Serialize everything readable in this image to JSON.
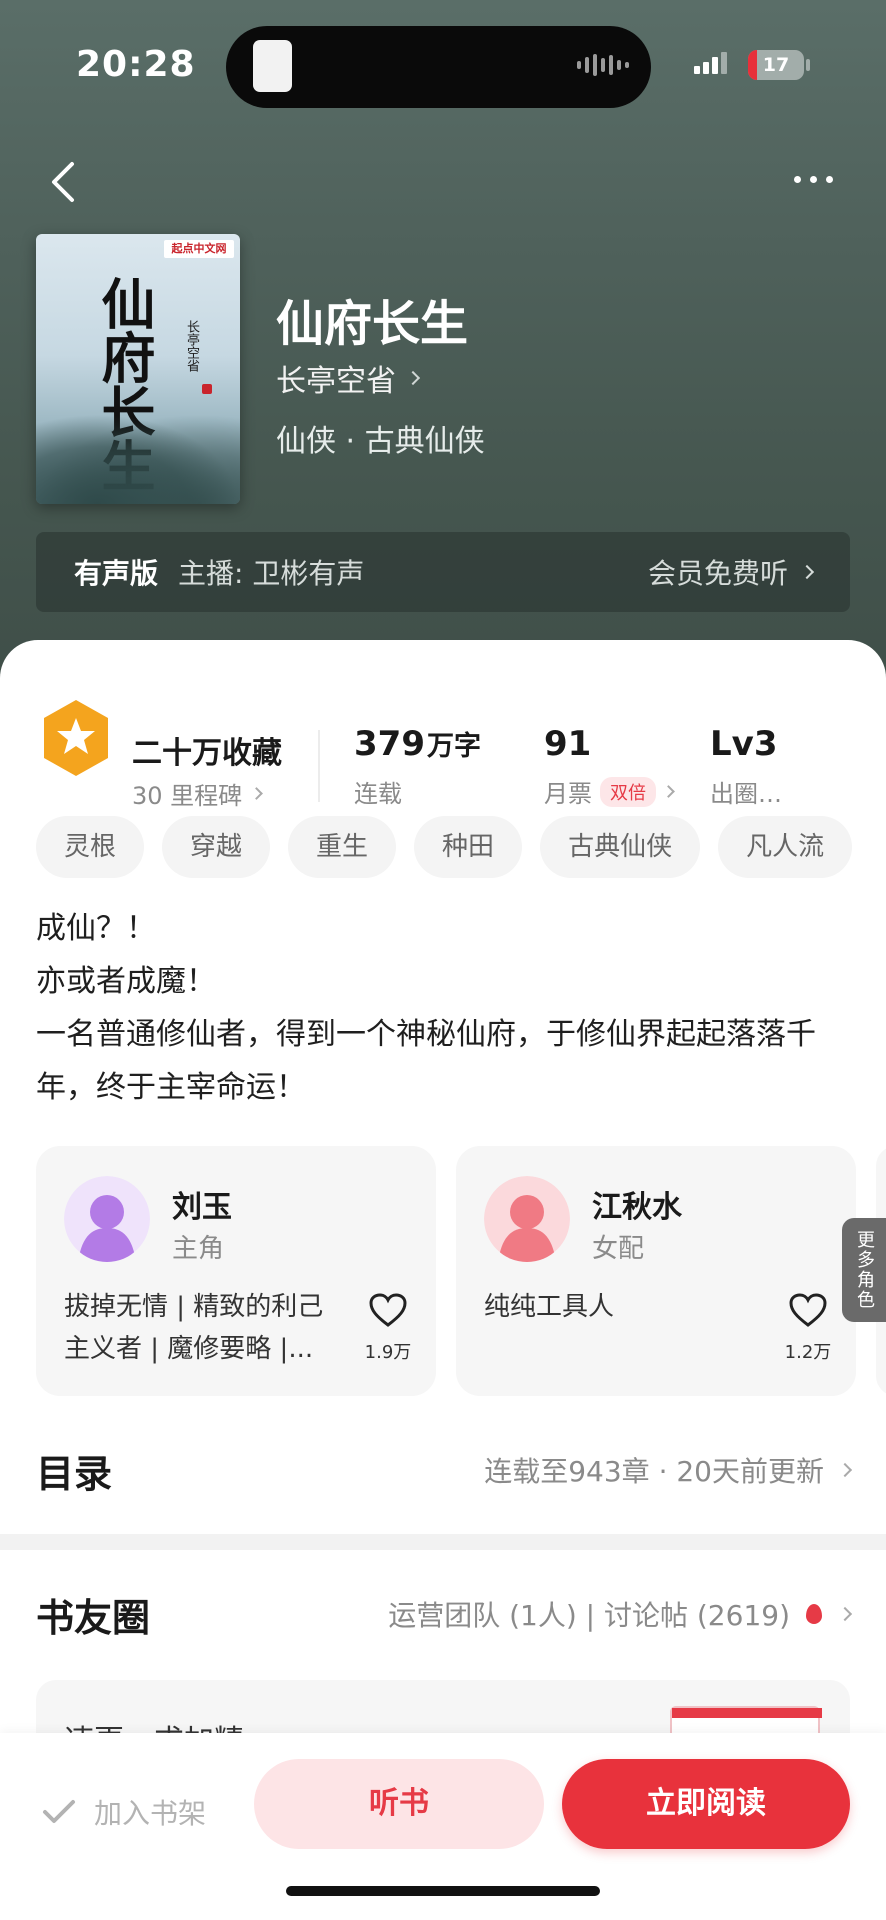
{
  "status_bar": {
    "time": "20:28",
    "battery": "17"
  },
  "book": {
    "title": "仙府长生",
    "author": "长亭空省",
    "genre": "仙侠 · 古典仙侠",
    "cover": {
      "big_title": "仙府长生",
      "small_text": "长亭空省",
      "brand": "起点中文网"
    }
  },
  "audio_bar": {
    "tag": "有声版",
    "host": "主播:  卫彬有声",
    "action": "会员免费听"
  },
  "stats": {
    "favorites": "二十万收藏",
    "milestones": "30 里程碑",
    "word_count": "379",
    "word_unit": "万字",
    "word_label": "连载",
    "monthly_tickets": "91",
    "monthly_label": "月票",
    "double_badge": "双倍",
    "level": "Lv3",
    "level_label": "出圈…"
  },
  "tags": [
    "灵根",
    "穿越",
    "重生",
    "种田",
    "古典仙侠",
    "凡人流"
  ],
  "description": [
    "成仙？！",
    "亦或者成魔！",
    "一名普通修仙者，得到一个神秘仙府，于修仙界起起落落千年，终于主宰命运！"
  ],
  "roles": [
    {
      "name": "刘玉",
      "kind": "主角",
      "bio": "拔掉无情 | 精致的利己主义者 | 魔修要略 |...",
      "likes": "1.9万",
      "color": "#b37be6"
    },
    {
      "name": "江秋水",
      "kind": "女配",
      "bio": "纯纯工具人",
      "likes": "1.2万",
      "color": "#f07a84"
    }
  ],
  "more_roles": "更多角色",
  "toc": {
    "title": "目录",
    "info": "连载至943章 · 20天前更新"
  },
  "circle": {
    "title": "书友圈",
    "info": "运营团队 (1人) | 讨论帖 (2619)"
  },
  "post_preview": "速更，求加精",
  "bottom_bar": {
    "shelf": "加入书架",
    "listen": "听书",
    "read": "立即阅读"
  },
  "colors": {
    "accent": "#e8323c",
    "header": "#4f615b",
    "medal": "#f4a41e"
  }
}
